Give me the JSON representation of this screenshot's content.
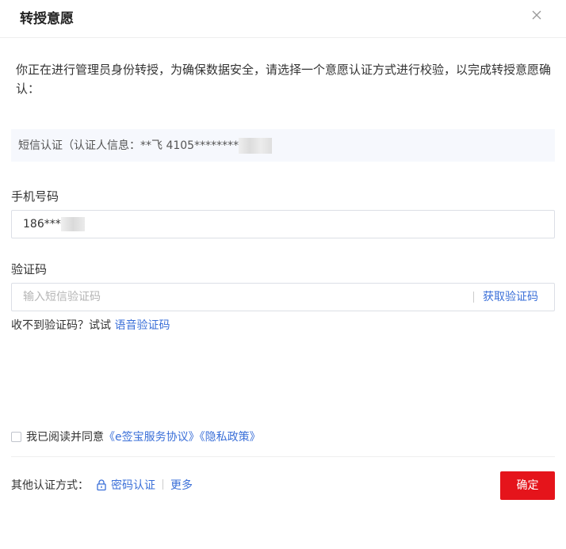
{
  "dialog": {
    "title": "转授意愿",
    "description": "你正在进行管理员身份转授，为确保数据安全，请选择一个意愿认证方式进行校验，以完成转授意愿确认："
  },
  "method": {
    "text": "短信认证（认证人信息：**飞 4105********"
  },
  "phone": {
    "label": "手机号码",
    "value": "186***"
  },
  "code": {
    "label": "验证码",
    "placeholder": "输入短信验证码",
    "get_code": "获取验证码"
  },
  "voice": {
    "prefix": "收不到验证码？试试",
    "link": "语音验证码"
  },
  "agreement": {
    "prefix": "我已阅读并同意",
    "service_link": "《e签宝服务协议》",
    "privacy_link": "《隐私政策》"
  },
  "other_methods": {
    "label": "其他认证方式：",
    "password": "密码认证",
    "more": "更多"
  },
  "actions": {
    "confirm": "确定"
  },
  "colors": {
    "link": "#3a6fd8",
    "primary_button": "#e5141b"
  },
  "icons": {
    "close": "close-icon",
    "lock": "lock-icon"
  }
}
